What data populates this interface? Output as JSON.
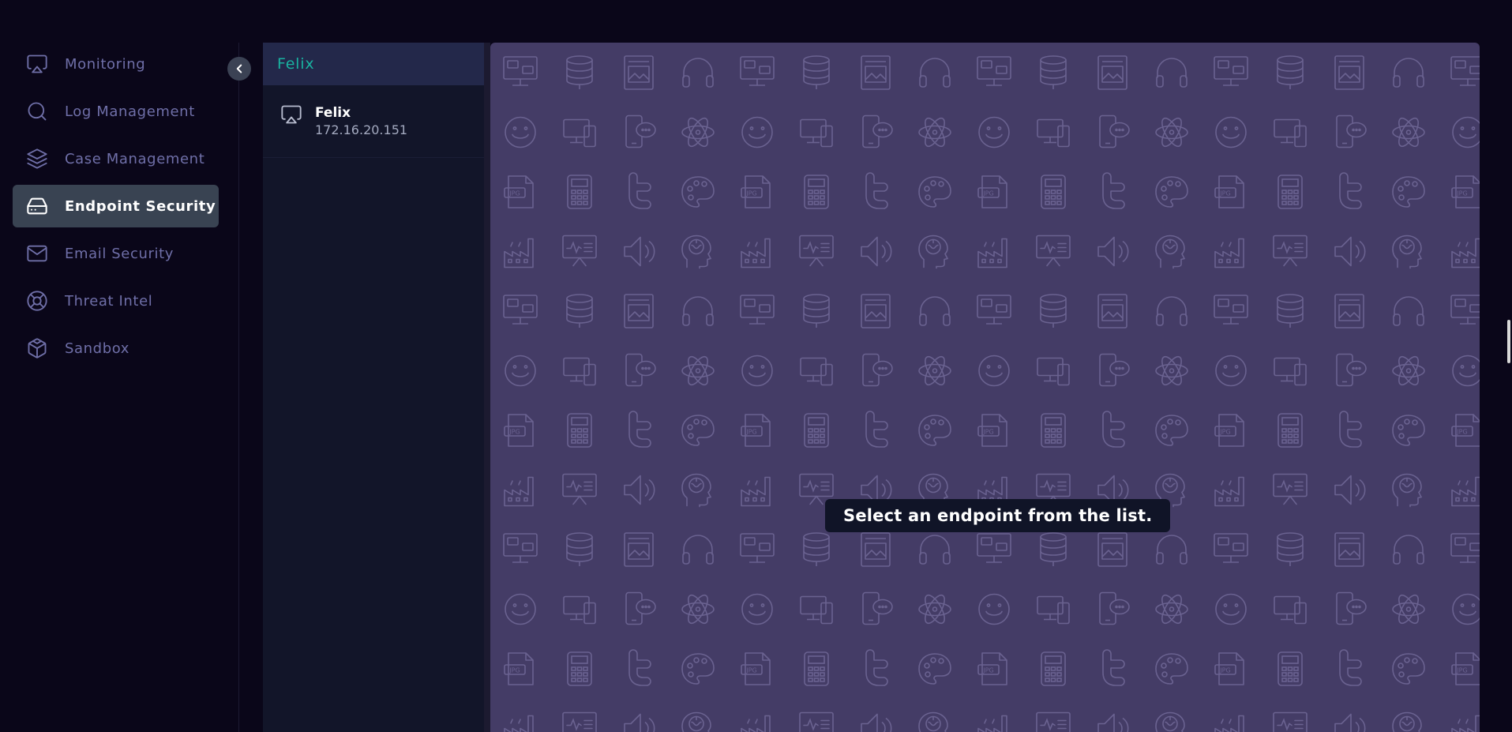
{
  "sidebar": {
    "collapse_icon": "chevron-left-icon",
    "items": [
      {
        "label": "Monitoring",
        "icon": "monitor-icon",
        "active": false
      },
      {
        "label": "Log Management",
        "icon": "search-icon",
        "active": false
      },
      {
        "label": "Case Management",
        "icon": "layers-icon",
        "active": false
      },
      {
        "label": "Endpoint Security",
        "icon": "hard-drive-icon",
        "active": true
      },
      {
        "label": "Email Security",
        "icon": "mail-icon",
        "active": false
      },
      {
        "label": "Threat Intel",
        "icon": "life-buoy-icon",
        "active": false
      },
      {
        "label": "Sandbox",
        "icon": "box-icon",
        "active": false
      }
    ]
  },
  "endpoint_list": {
    "search": {
      "value": "Felix",
      "icon": "search-icon"
    },
    "items": [
      {
        "name": "Felix",
        "ip": "172.16.20.151",
        "icon": "airplay-icon"
      }
    ]
  },
  "content": {
    "placeholder": "Select an endpoint from the list."
  },
  "colors": {
    "background": "#0a0619",
    "active_nav": "#394352",
    "nav_text": "#6f6fa8",
    "search_bar": "#23284a",
    "search_text": "#19b2a0",
    "list_panel": "#121529",
    "content_bg": "#443c66",
    "pattern_stroke": "#6a6290"
  }
}
